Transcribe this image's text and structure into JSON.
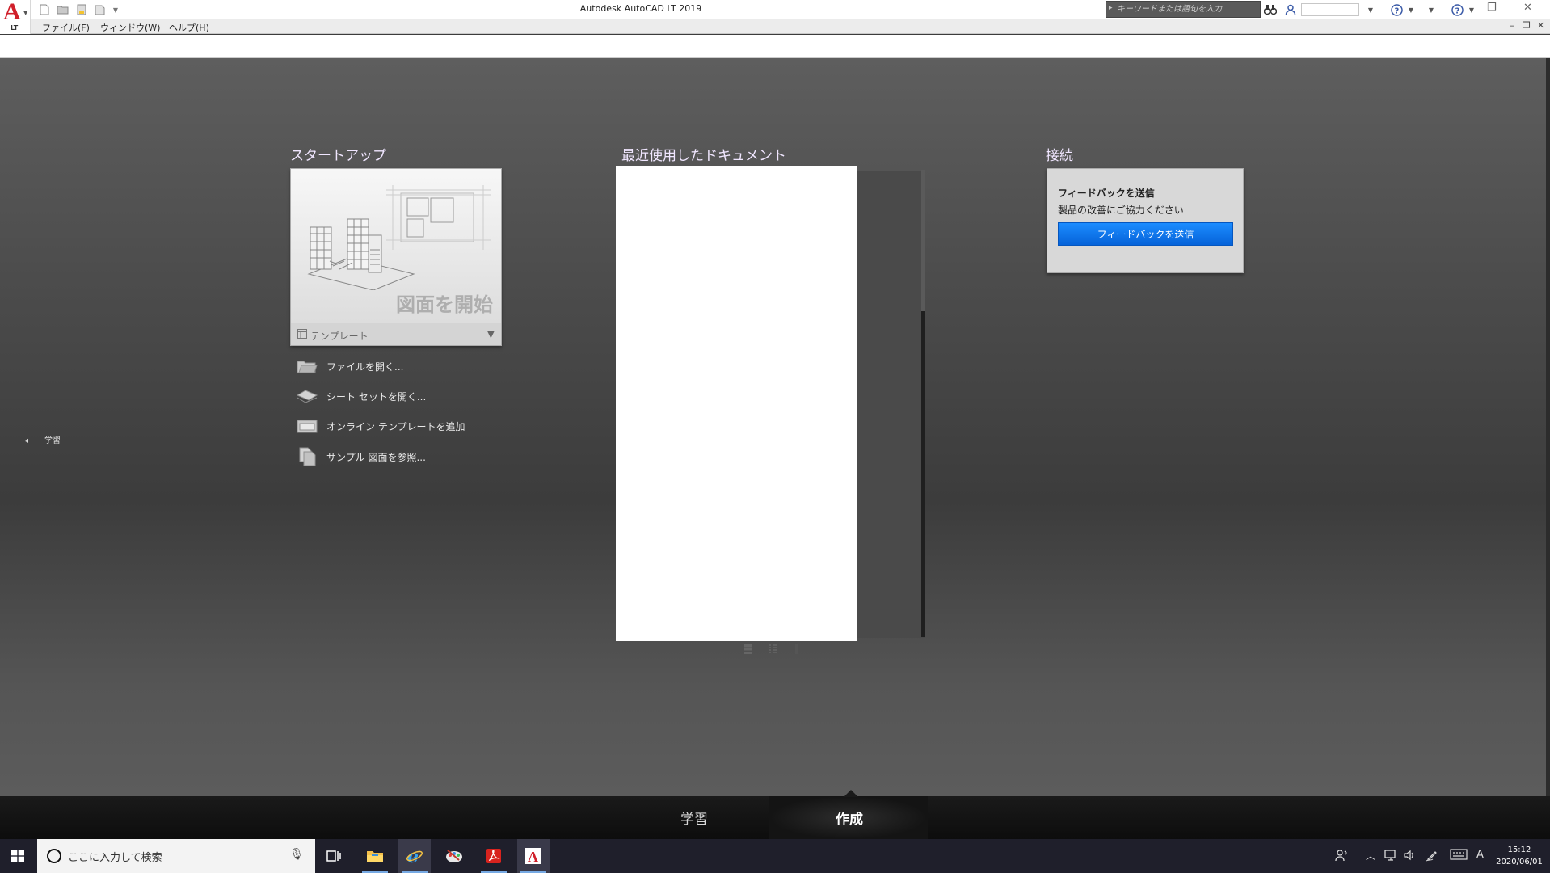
{
  "titlebar": {
    "app_title": "Autodesk AutoCAD LT 2019",
    "logo_letter": "A",
    "logo_sub": "LT",
    "search_placeholder": "キーワードまたは語句を入力"
  },
  "menubar": {
    "items": [
      "ファイル(F)",
      "ウィンドウ(W)",
      "ヘルプ(H)"
    ]
  },
  "startup": {
    "section_title": "スタートアップ",
    "start_drawing_label": "図面を開始",
    "template_label": "テンプレート",
    "actions": [
      {
        "label": "ファイルを開く...",
        "icon": "folder-icon"
      },
      {
        "label": "シート セットを開く...",
        "icon": "sheet-set-icon"
      },
      {
        "label": "オンライン テンプレートを追加",
        "icon": "online-template-icon"
      },
      {
        "label": "サンプル 図面を参照...",
        "icon": "sample-drawing-icon"
      }
    ]
  },
  "left_tab": {
    "label": "学習"
  },
  "recent": {
    "section_title": "最近使用したドキュメント"
  },
  "connect": {
    "section_title": "接続",
    "feedback_heading": "フィードバックを送信",
    "feedback_subtext": "製品の改善にご協力ください",
    "feedback_button": "フィードバックを送信"
  },
  "bottom_tabs": [
    {
      "label": "学習",
      "active": false
    },
    {
      "label": "作成",
      "active": true
    }
  ],
  "taskbar": {
    "search_placeholder": "ここに入力して検索",
    "ime_indicator": "A",
    "time": "15:12",
    "date": "2020/06/01"
  },
  "colors": {
    "accent_blue": "#0a74f0",
    "autocad_red": "#d01f2a",
    "section_title": "#f0e6ff"
  }
}
